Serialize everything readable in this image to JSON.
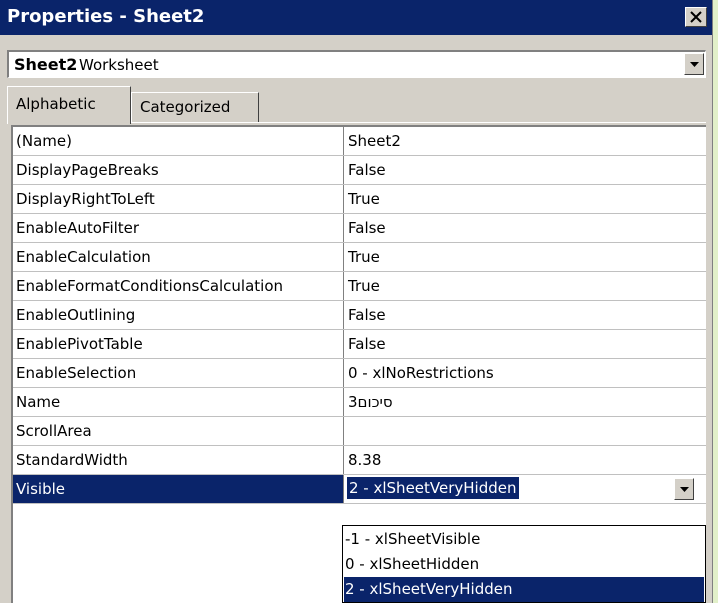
{
  "window": {
    "title": "Properties - Sheet2"
  },
  "object_selector": {
    "name": "Sheet2",
    "type": "Worksheet"
  },
  "tabs": [
    {
      "label": "Alphabetic",
      "active": true
    },
    {
      "label": "Categorized",
      "active": false
    }
  ],
  "properties": [
    {
      "name": "(Name)",
      "value": "Sheet2"
    },
    {
      "name": "DisplayPageBreaks",
      "value": "False"
    },
    {
      "name": "DisplayRightToLeft",
      "value": "True"
    },
    {
      "name": "EnableAutoFilter",
      "value": "False"
    },
    {
      "name": "EnableCalculation",
      "value": "True"
    },
    {
      "name": "EnableFormatConditionsCalculation",
      "value": "True"
    },
    {
      "name": "EnableOutlining",
      "value": "False"
    },
    {
      "name": "EnablePivotTable",
      "value": "False"
    },
    {
      "name": "EnableSelection",
      "value": "0 - xlNoRestrictions"
    },
    {
      "name": "Name",
      "value": "סיכום3"
    },
    {
      "name": "ScrollArea",
      "value": ""
    },
    {
      "name": "StandardWidth",
      "value": "8.38"
    },
    {
      "name": "Visible",
      "value": "2 - xlSheetVeryHidden"
    }
  ],
  "selected_property": "Visible",
  "visible_options": [
    "-1 - xlSheetVisible",
    "0 - xlSheetHidden",
    "2 - xlSheetVeryHidden"
  ],
  "selected_option_index": 2,
  "colors": {
    "title_bar": "#0a246a",
    "selection": "#0a246a",
    "face": "#d4d0c8",
    "backdrop": "#e2f0c9"
  },
  "icons": {
    "close": "close-icon",
    "dropdown": "chevron-down-icon"
  }
}
